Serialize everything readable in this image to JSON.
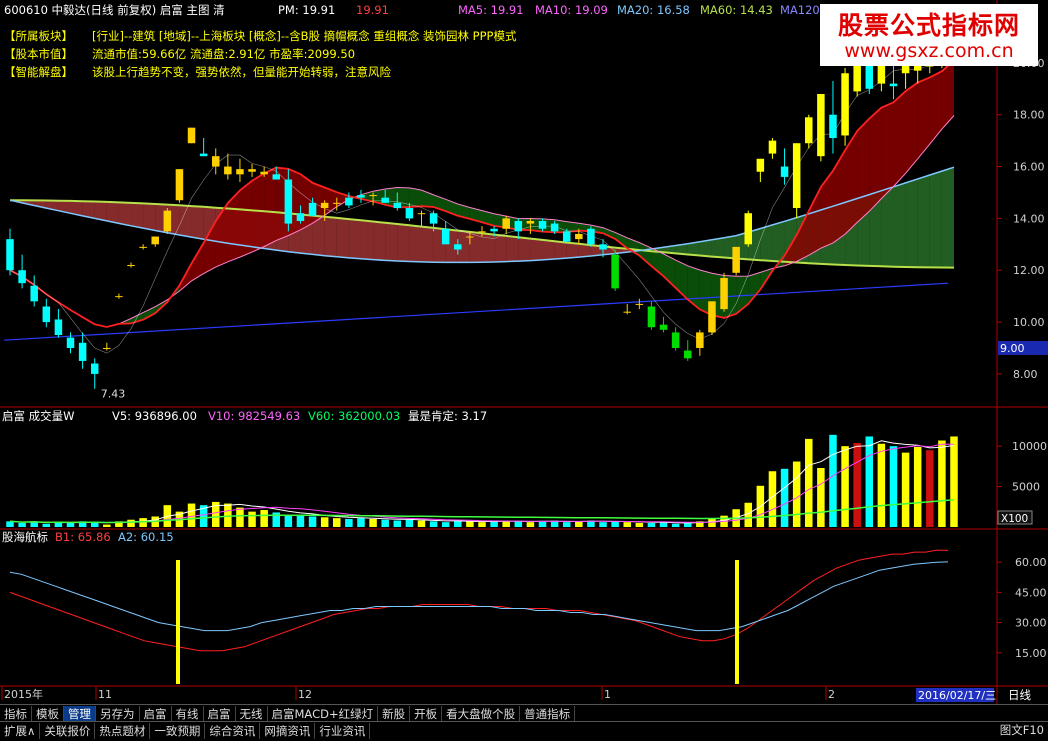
{
  "title_bar": {
    "stock": "600610 中毅达(日线 前复权) 启富 主图 清",
    "pm_label": "PM: 19.91",
    "pm_value": "19.91",
    "ma5": "MA5: 19.91",
    "ma10": "MA10: 19.09",
    "ma20": "MA20: 16.58",
    "ma60": "MA60: 14.43",
    "ma120": "MA120:"
  },
  "info": {
    "row1_label": "【所属板块】",
    "row1_text": "[行业]--建筑   [地域]--上海板块   [概念]--含B股 摘帽概念 重组概念 装饰园林 PPP模式",
    "row2_label": "【股本市值】",
    "row2_text": "流通市值:59.66亿    流通盘:2.91亿     市盈率:2099.50",
    "row3_label": "【智能解盘】",
    "row3_text": "该股上行趋势不变，强势依然，但量能开始转弱，注意风险"
  },
  "watermark": {
    "line1": "股票公式指标网",
    "line2": "www.gsxz.com.cn"
  },
  "price_axis": {
    "ticks": [
      "20.00",
      "18.00",
      "16.00",
      "14.00",
      "12.00",
      "10.00",
      "8.00"
    ],
    "current": "9.00",
    "low_label": "7.43"
  },
  "volume_panel": {
    "title": "启富 成交量W",
    "v5": "V5: 936896.00",
    "v10": "V10: 982549.63",
    "v60": "V60: 362000.03",
    "ratio": "量是肯定: 3.17",
    "ticks": [
      "10000",
      "5000"
    ],
    "unit": "X100"
  },
  "indicator_panel": {
    "title": "股海航标",
    "b1": "B1: 65.86",
    "a2": "A2: 60.15",
    "ticks": [
      "60.00",
      "45.00",
      "30.00",
      "15.00"
    ]
  },
  "date_axis": {
    "labels": [
      "2015年",
      "11",
      "12",
      "1",
      "2"
    ],
    "current_date": "2016/02/17/三",
    "period": "日线"
  },
  "toolbar1": [
    "指标",
    "模板",
    "管理",
    "另存为",
    "启富",
    "有线",
    "启富",
    "无线",
    "启富MACD+红绿灯",
    "新股",
    "开板",
    "看大盘做个股",
    "普通指标"
  ],
  "toolbar2": [
    "扩展∧",
    "关联报价",
    "热点题材",
    "一致预期",
    "综合资讯",
    "网摘资讯",
    "行业资讯"
  ],
  "toolbar2_right": "图文F10",
  "colors": {
    "up": "#ffff00",
    "down": "#00ffff",
    "green": "#00dd00",
    "red": "#ff3333",
    "axis": "#b00000"
  },
  "chart_data": {
    "type": "candlestick",
    "price_ylim": [
      6.8,
      21.5
    ],
    "candles": [
      [
        13.2,
        13.6,
        11.8,
        12.0
      ],
      [
        12.0,
        12.6,
        11.3,
        11.5
      ],
      [
        11.4,
        11.8,
        10.6,
        10.8
      ],
      [
        10.6,
        10.9,
        9.8,
        10.0
      ],
      [
        10.1,
        10.5,
        9.4,
        9.5
      ],
      [
        9.4,
        9.6,
        8.8,
        9.0
      ],
      [
        9.2,
        9.6,
        8.2,
        8.5
      ],
      [
        8.4,
        8.6,
        7.43,
        8.0
      ],
      [
        9.0,
        9.2,
        8.9,
        9.0
      ],
      [
        11.0,
        11.1,
        10.9,
        11.0
      ],
      [
        12.2,
        12.3,
        12.1,
        12.2
      ],
      [
        12.9,
        13.0,
        12.8,
        12.9
      ],
      [
        13.0,
        13.3,
        12.9,
        13.3
      ],
      [
        13.5,
        14.4,
        13.4,
        14.3
      ],
      [
        14.7,
        15.9,
        14.6,
        15.9
      ],
      [
        16.9,
        17.5,
        16.9,
        17.5
      ],
      [
        16.5,
        17.1,
        16.4,
        16.4
      ],
      [
        16.0,
        16.7,
        15.7,
        16.4
      ],
      [
        15.7,
        16.5,
        15.5,
        16.0
      ],
      [
        15.7,
        16.3,
        15.4,
        15.9
      ],
      [
        15.8,
        16.1,
        15.6,
        15.9
      ],
      [
        15.7,
        16.0,
        15.6,
        15.8
      ],
      [
        15.7,
        16.0,
        15.5,
        15.5
      ],
      [
        15.5,
        15.9,
        13.5,
        13.8
      ],
      [
        14.2,
        14.5,
        13.8,
        13.9
      ],
      [
        14.6,
        14.8,
        14.1,
        14.1
      ],
      [
        14.4,
        14.7,
        13.9,
        14.6
      ],
      [
        14.6,
        14.8,
        14.3,
        14.6
      ],
      [
        14.8,
        15.0,
        14.4,
        14.5
      ],
      [
        14.9,
        15.1,
        14.6,
        14.8
      ],
      [
        14.9,
        15.0,
        14.5,
        14.9
      ],
      [
        14.8,
        15.1,
        14.6,
        14.6
      ],
      [
        14.6,
        15.0,
        14.3,
        14.4
      ],
      [
        14.4,
        14.6,
        13.9,
        14.0
      ],
      [
        14.2,
        14.3,
        13.7,
        14.2
      ],
      [
        14.2,
        14.3,
        13.5,
        13.8
      ],
      [
        13.6,
        13.9,
        13.0,
        13.0
      ],
      [
        13.0,
        13.2,
        12.6,
        12.8
      ],
      [
        13.3,
        13.5,
        13.0,
        13.3
      ],
      [
        13.5,
        13.7,
        13.3,
        13.5
      ],
      [
        13.6,
        13.7,
        13.3,
        13.5
      ],
      [
        13.6,
        14.1,
        13.4,
        14.0
      ],
      [
        13.9,
        14.0,
        13.2,
        13.5
      ],
      [
        13.8,
        14.0,
        13.4,
        13.9
      ],
      [
        13.9,
        14.0,
        13.5,
        13.6
      ],
      [
        13.8,
        13.9,
        13.4,
        13.5
      ],
      [
        13.5,
        13.6,
        13.1,
        13.1
      ],
      [
        13.2,
        13.6,
        13.0,
        13.4
      ],
      [
        13.6,
        13.7,
        12.9,
        13.0
      ],
      [
        13.0,
        13.2,
        12.5,
        12.8
      ],
      [
        12.6,
        12.8,
        11.2,
        11.3
      ],
      [
        10.4,
        10.7,
        10.3,
        10.4
      ],
      [
        10.7,
        10.9,
        10.5,
        10.7
      ],
      [
        10.6,
        10.8,
        9.7,
        9.8
      ],
      [
        9.9,
        10.2,
        9.6,
        9.7
      ],
      [
        9.6,
        9.8,
        8.9,
        9.0
      ],
      [
        8.9,
        9.3,
        8.5,
        8.6
      ],
      [
        9.0,
        9.7,
        8.7,
        9.6
      ],
      [
        9.6,
        10.8,
        9.5,
        10.8
      ],
      [
        10.5,
        11.9,
        10.4,
        11.7
      ],
      [
        11.9,
        12.9,
        11.8,
        12.9
      ],
      [
        13.0,
        14.3,
        12.9,
        14.2
      ],
      [
        15.8,
        16.3,
        15.4,
        16.3
      ],
      [
        16.5,
        17.1,
        16.3,
        17.0
      ],
      [
        16.0,
        16.7,
        15.3,
        15.6
      ],
      [
        14.4,
        16.9,
        14.0,
        16.9
      ],
      [
        16.9,
        18.0,
        16.7,
        17.9
      ],
      [
        16.4,
        18.8,
        16.2,
        18.8
      ],
      [
        18.0,
        19.3,
        16.5,
        17.1
      ],
      [
        17.2,
        19.8,
        16.8,
        19.6
      ],
      [
        18.9,
        20.4,
        18.7,
        20.3
      ],
      [
        20.2,
        21.3,
        18.8,
        19.0
      ],
      [
        19.2,
        20.8,
        18.9,
        20.5
      ],
      [
        19.2,
        20.5,
        18.6,
        19.1
      ],
      [
        19.6,
        20.6,
        19.0,
        19.9
      ],
      [
        19.7,
        20.2,
        19.2,
        20.2
      ],
      [
        19.9,
        20.7,
        19.6,
        19.9
      ],
      [
        19.9,
        21.2,
        19.8,
        21.2
      ],
      [
        20.8,
        21.4,
        20.4,
        21.3
      ]
    ],
    "volume_ylim": [
      0,
      12000
    ],
    "volumes": [
      700,
      500,
      700,
      400,
      600,
      500,
      700,
      600,
      300,
      700,
      900,
      1100,
      1300,
      2700,
      1900,
      2900,
      2700,
      3100,
      2900,
      2400,
      1900,
      2100,
      1800,
      1500,
      1400,
      1300,
      1200,
      1100,
      1000,
      1100,
      1000,
      900,
      800,
      900,
      800,
      700,
      600,
      800,
      700,
      600,
      700,
      800,
      700,
      600,
      700,
      800,
      600,
      700,
      800,
      600,
      700,
      600,
      500,
      500,
      600,
      400,
      500,
      700,
      1000,
      1400,
      2200,
      3000,
      5100,
      6900,
      7200,
      8100,
      10900,
      7300,
      11400,
      10000,
      10400,
      11200,
      10300,
      10000,
      9200,
      9900,
      9500,
      10700,
      11200
    ],
    "b1": [
      45,
      43,
      41,
      39,
      37,
      35,
      33,
      31,
      29,
      27,
      25,
      23,
      21,
      20,
      19,
      18,
      17,
      16,
      16,
      16,
      17,
      18,
      20,
      22,
      24,
      26,
      28,
      30,
      32,
      34,
      35,
      36,
      37,
      37,
      38,
      38,
      38,
      39,
      39,
      39,
      39,
      39,
      38,
      38,
      38,
      37,
      37,
      37,
      37,
      36,
      36,
      36,
      35,
      34,
      33,
      32,
      31,
      29,
      27,
      25,
      23,
      22,
      21,
      21,
      22,
      24,
      27,
      31,
      35,
      39,
      43,
      47,
      51,
      54,
      57,
      59,
      61,
      62,
      63,
      64,
      64,
      65,
      65,
      66,
      65.86
    ],
    "a2": [
      55,
      54,
      52,
      50,
      48,
      46,
      44,
      42,
      40,
      38,
      36,
      34,
      32,
      30,
      29,
      28,
      27,
      26,
      26,
      26,
      27,
      28,
      30,
      31,
      32,
      33,
      34,
      35,
      36,
      36,
      37,
      37,
      38,
      38,
      38,
      38,
      38,
      38,
      38,
      38,
      38,
      38,
      38,
      37,
      37,
      37,
      36,
      36,
      36,
      35,
      35,
      34,
      34,
      33,
      32,
      31,
      30,
      29,
      28,
      27,
      26,
      26,
      26,
      27,
      28,
      30,
      32,
      34,
      36,
      39,
      42,
      45,
      48,
      50,
      52,
      54,
      56,
      57,
      58,
      59,
      59.5,
      60,
      60.15
    ],
    "indicator_ylim": [
      0,
      72
    ]
  }
}
